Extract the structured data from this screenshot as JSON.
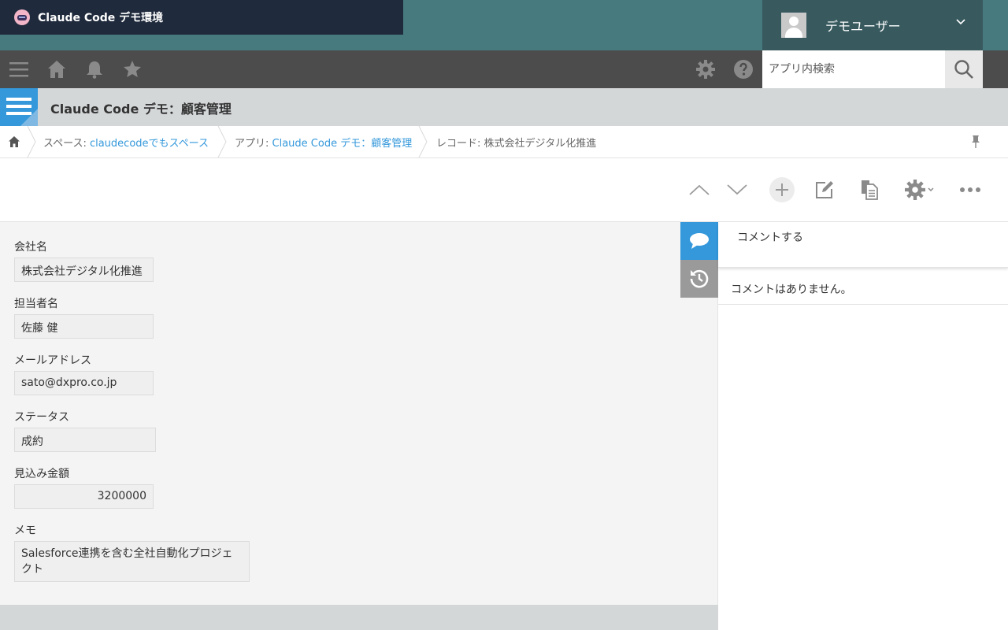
{
  "header": {
    "brand_title": "Claude Code デモ環境",
    "user_name": "デモユーザー"
  },
  "toolbar": {
    "search_placeholder": "アプリ内検索"
  },
  "app": {
    "title": "Claude Code デモ：顧客管理"
  },
  "breadcrumb": {
    "space_prefix": "スペース: ",
    "space_name": "claudecodeでもスペース",
    "app_prefix": "アプリ: ",
    "app_name": "Claude Code デモ：顧客管理",
    "record_label": "レコード: 株式会社デジタル化推進"
  },
  "record": {
    "fields": [
      {
        "label": "会社名",
        "value": "株式会社デジタル化推進"
      },
      {
        "label": "担当者名",
        "value": "佐藤 健"
      },
      {
        "label": "メールアドレス",
        "value": "sato@dxpro.co.jp"
      },
      {
        "label": "ステータス",
        "value": "成約"
      },
      {
        "label": "見込み金額",
        "value": "3200000"
      },
      {
        "label": "メモ",
        "value": "Salesforce連携を含む全社自動化プロジェクト"
      }
    ]
  },
  "side": {
    "comment_placeholder": "コメントする",
    "no_comments": "コメントはありません。"
  },
  "colors": {
    "header_teal": "#477a7e",
    "brand_navy": "#1f2a3c",
    "toolbar_gray": "#4c4c4c",
    "accent_blue": "#3498db"
  }
}
